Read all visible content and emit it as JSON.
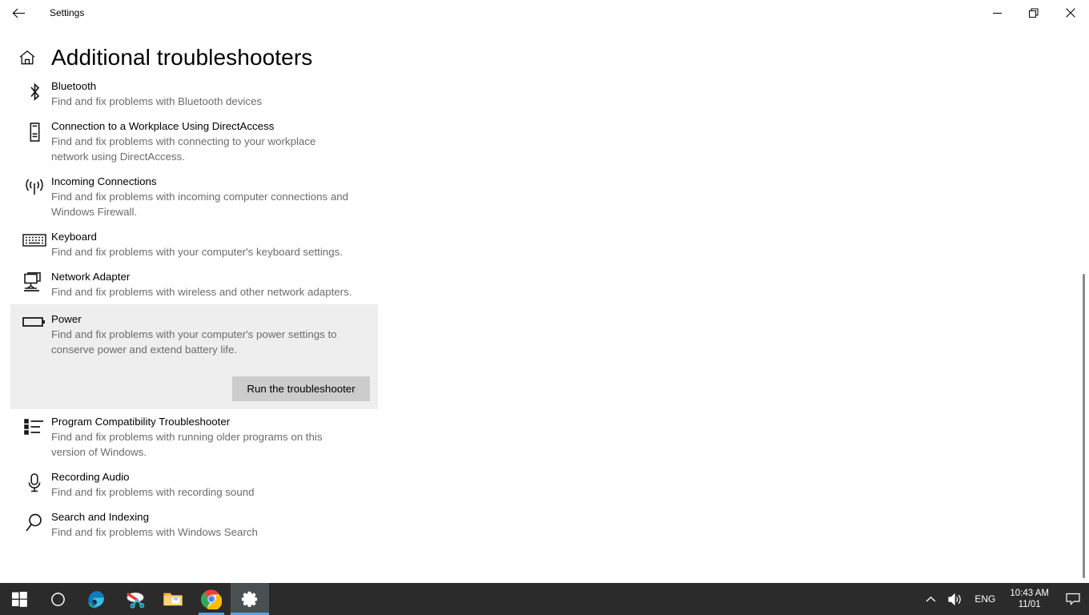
{
  "window": {
    "titlebar_title": "Settings",
    "back_icon": "back-arrow-icon",
    "minimize_label": "—",
    "maximize_label": "restore-icon",
    "close_label": "close-icon"
  },
  "header": {
    "home_icon": "home-icon",
    "title": "Additional troubleshooters"
  },
  "troubleshooters": [
    {
      "icon": "bluetooth-icon",
      "title": "Bluetooth",
      "description": "Find and fix problems with Bluetooth devices",
      "selected": false
    },
    {
      "icon": "workplace-tower-icon",
      "title": "Connection to a Workplace Using DirectAccess",
      "description": "Find and fix problems with connecting to your workplace network using DirectAccess.",
      "selected": false
    },
    {
      "icon": "incoming-connections-icon",
      "title": "Incoming Connections",
      "description": "Find and fix problems with incoming computer connections and Windows Firewall.",
      "selected": false
    },
    {
      "icon": "keyboard-icon",
      "title": "Keyboard",
      "description": "Find and fix problems with your computer's keyboard settings.",
      "selected": false
    },
    {
      "icon": "network-adapter-icon",
      "title": "Network Adapter",
      "description": "Find and fix problems with wireless and other network adapters.",
      "selected": false
    },
    {
      "icon": "battery-icon",
      "title": "Power",
      "description": "Find and fix problems with your computer's power settings to conserve power and extend battery life.",
      "selected": true,
      "action_button": "Run the troubleshooter"
    },
    {
      "icon": "program-list-icon",
      "title": "Program Compatibility Troubleshooter",
      "description": "Find and fix problems with running older programs on this version of Windows.",
      "selected": false
    },
    {
      "icon": "microphone-icon",
      "title": "Recording Audio",
      "description": "Find and fix problems with recording sound",
      "selected": false
    },
    {
      "icon": "search-icon",
      "title": "Search and Indexing",
      "description": "Find and fix problems with Windows Search",
      "selected": false
    }
  ],
  "taskbar": {
    "items": [
      {
        "icon": "windows-start-icon",
        "name": "start-button",
        "state": "idle"
      },
      {
        "icon": "cortana-circle-icon",
        "name": "cortana-button",
        "state": "idle"
      },
      {
        "icon": "edge-icon",
        "name": "microsoft-edge",
        "state": "idle"
      },
      {
        "icon": "snipping-tool-icon",
        "name": "snipping-tool",
        "state": "idle"
      },
      {
        "icon": "file-explorer-icon",
        "name": "file-explorer",
        "state": "idle"
      },
      {
        "icon": "chrome-icon",
        "name": "google-chrome",
        "state": "running"
      },
      {
        "icon": "settings-gear-icon",
        "name": "settings-app",
        "state": "active"
      }
    ],
    "tray": {
      "chevron_icon": "show-hidden-icons-chevron",
      "volume_icon": "volume-icon",
      "language": "ENG",
      "time": "10:43 AM",
      "date": "11/01",
      "action_center_icon": "action-center-icon"
    }
  },
  "colors": {
    "accent": "#5aa2e0",
    "selected_row_bg": "#eeeeee",
    "button_bg": "#cccccc",
    "taskbar_bg": "#2b2b2b",
    "text_primary": "#000000",
    "text_secondary": "#6b6b6b"
  }
}
